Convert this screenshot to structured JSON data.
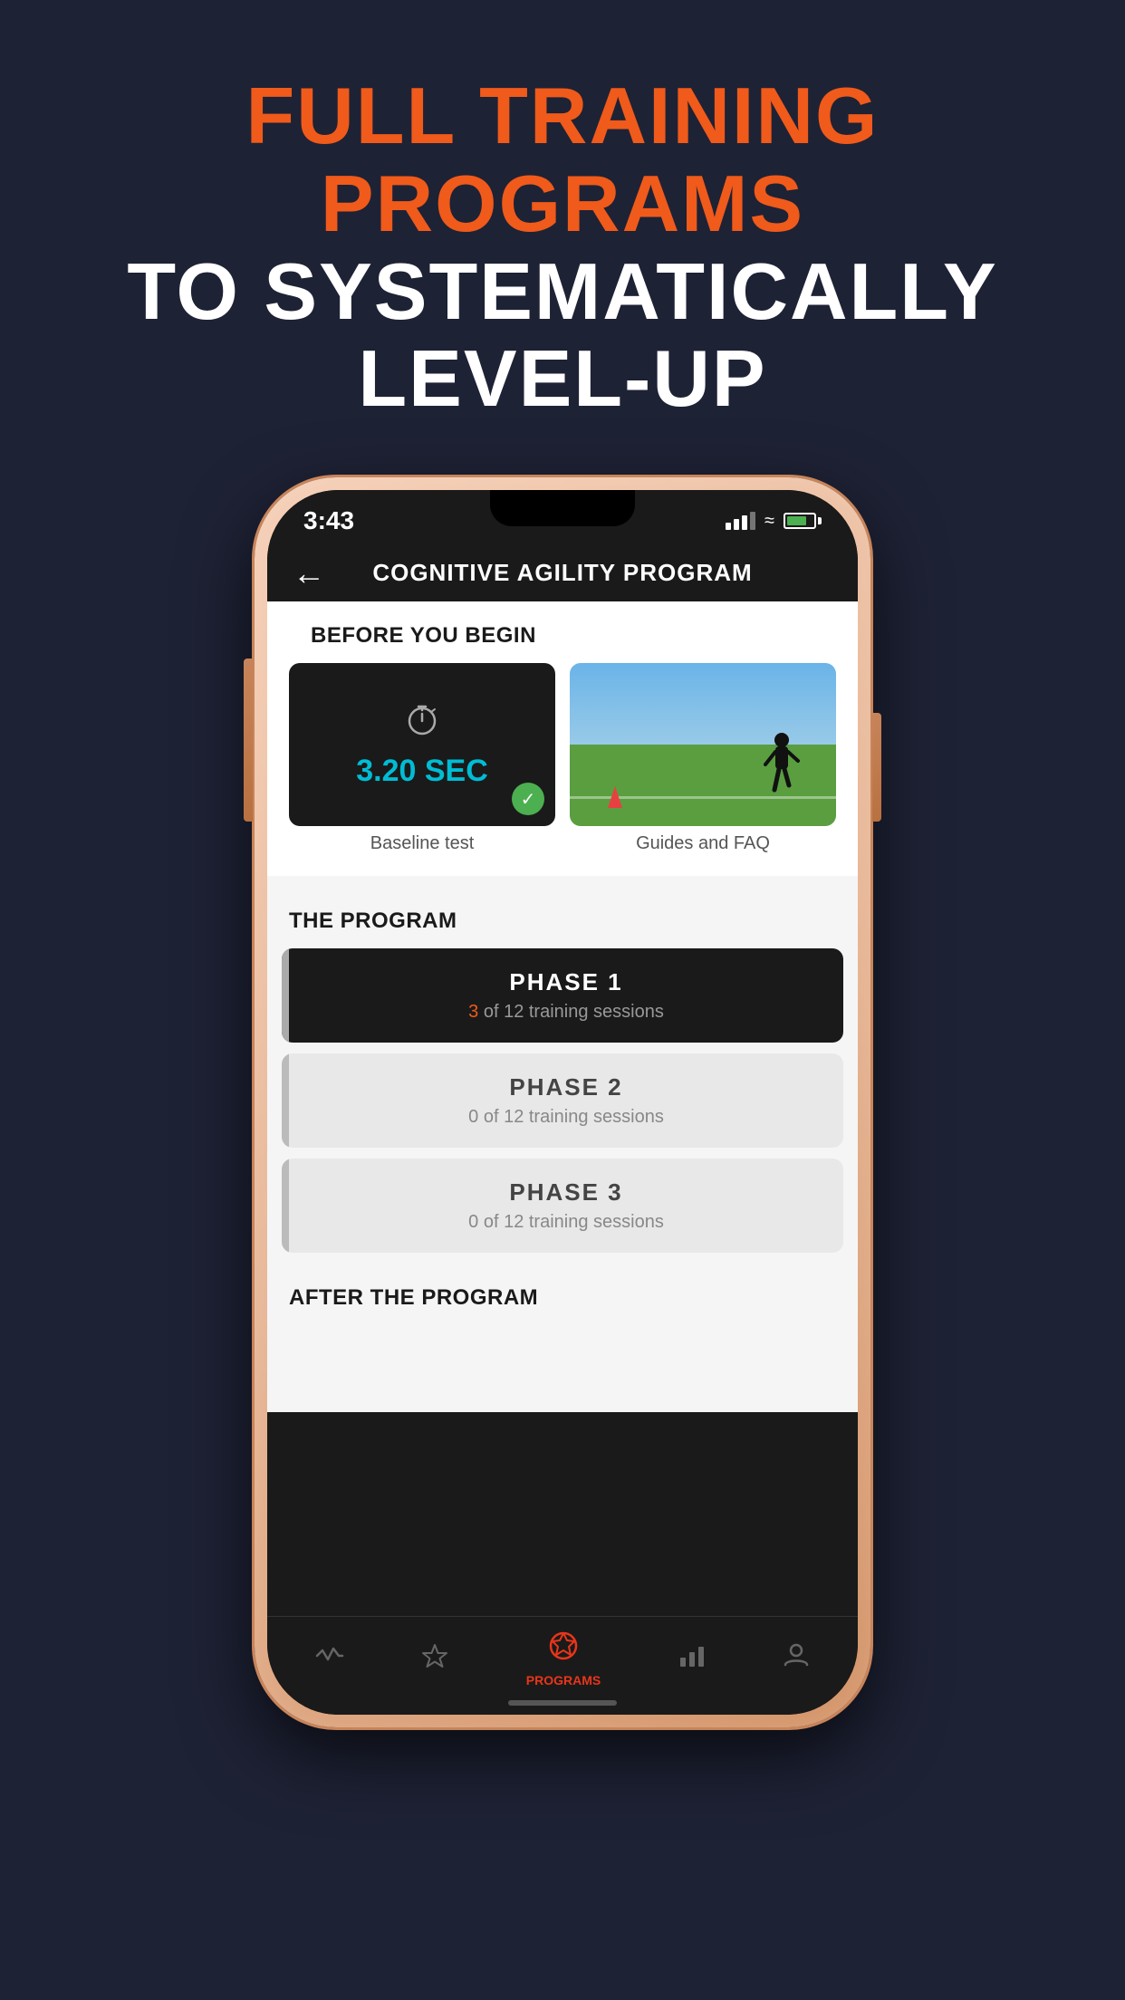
{
  "hero": {
    "line1": "FULL TRAINING PROGRAMS",
    "line2": "TO SYSTEMATICALLY LEVEL-UP"
  },
  "phone": {
    "status_bar": {
      "time": "3:43"
    },
    "nav": {
      "title": "COGNITIVE AGILITY PROGRAM",
      "back_label": "←"
    },
    "before_section": {
      "label": "BEFORE YOU BEGIN",
      "baseline_time": "3.20 SEC",
      "baseline_caption": "Baseline test",
      "guides_caption": "Guides and FAQ"
    },
    "program_section": {
      "label": "THE PROGRAM",
      "phases": [
        {
          "title": "PHASE 1",
          "subtitle_prefix": "",
          "highlight": "3",
          "subtitle_suffix": " of 12 training sessions",
          "active": true
        },
        {
          "title": "PHASE 2",
          "subtitle": "0 of 12 training sessions",
          "active": false
        },
        {
          "title": "PHASE 3",
          "subtitle": "0 of 12 training sessions",
          "active": false
        }
      ]
    },
    "after_section": {
      "label": "AFTER THE PROGRAM"
    },
    "bottom_nav": {
      "items": [
        {
          "icon": "activity-icon",
          "label": "",
          "active": false
        },
        {
          "icon": "star-icon",
          "label": "",
          "active": false
        },
        {
          "icon": "programs-icon",
          "label": "PROGRAMS",
          "active": true
        },
        {
          "icon": "chart-icon",
          "label": "",
          "active": false
        },
        {
          "icon": "profile-icon",
          "label": "",
          "active": false
        }
      ]
    }
  }
}
